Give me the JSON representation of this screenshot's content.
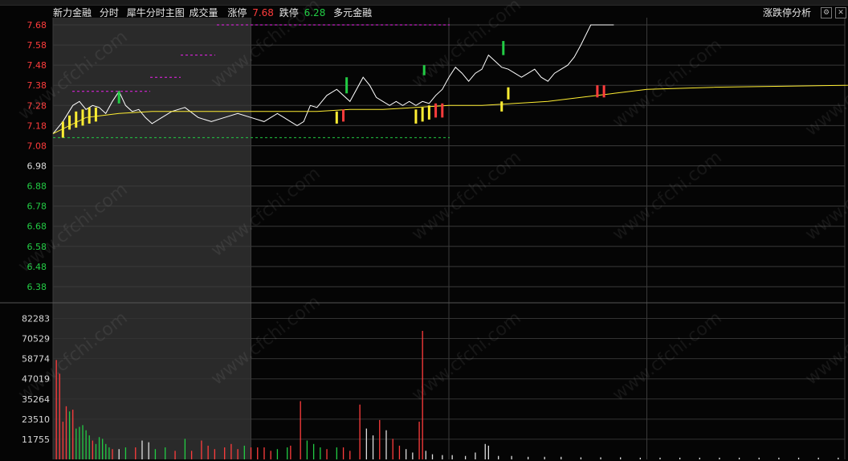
{
  "header": {
    "stock_name": "新力金融",
    "mode": "分时",
    "indicator": "犀牛分时主图",
    "volume_label": "成交量",
    "limit_up_label": "涨停",
    "limit_up_value": "7.68",
    "limit_down_label": "跌停",
    "limit_down_value": "6.28",
    "extra_label": "多元金融",
    "right_label": "涨跌停分析"
  },
  "watermark": "www.cfchi.com",
  "colors": {
    "up": "#ff3c3c",
    "down": "#22cc44",
    "neutral": "#dddddd",
    "avg_line": "#ffee33",
    "price_line": "#ffffff",
    "limit_dash": "#ee22ee",
    "low_dash": "#22cc44"
  },
  "chart_data": [
    {
      "type": "line",
      "title": "分时",
      "price_ticks": [
        "7.68",
        "7.58",
        "7.48",
        "7.38",
        "7.28",
        "7.18",
        "7.08",
        "6.98",
        "6.88",
        "6.78",
        "6.68",
        "6.58",
        "6.48",
        "6.38"
      ],
      "ylim": [
        6.32,
        7.7
      ],
      "prev_close": 6.98,
      "series": [
        {
          "name": "price",
          "x": [
            0,
            3,
            6,
            8,
            10,
            12,
            14,
            16,
            18,
            20,
            22,
            24,
            26,
            28,
            30,
            33,
            36,
            40,
            44,
            48,
            52,
            56,
            60,
            64,
            68,
            70,
            72,
            74,
            76,
            78,
            80,
            83,
            86,
            90,
            94,
            96,
            98,
            100,
            102,
            104,
            106,
            108,
            110,
            112,
            114,
            116,
            118,
            120,
            122,
            124,
            126,
            128,
            130,
            132,
            134,
            136,
            138,
            140,
            142,
            144,
            146,
            148,
            150,
            152,
            154,
            156,
            158,
            160,
            163,
            166,
            168,
            170
          ],
          "values": [
            7.14,
            7.2,
            7.28,
            7.3,
            7.26,
            7.28,
            7.27,
            7.24,
            7.3,
            7.35,
            7.28,
            7.25,
            7.26,
            7.22,
            7.19,
            7.22,
            7.25,
            7.27,
            7.22,
            7.2,
            7.22,
            7.24,
            7.22,
            7.2,
            7.24,
            7.22,
            7.2,
            7.18,
            7.2,
            7.28,
            7.27,
            7.33,
            7.36,
            7.3,
            7.42,
            7.38,
            7.32,
            7.3,
            7.28,
            7.3,
            7.28,
            7.3,
            7.28,
            7.3,
            7.29,
            7.33,
            7.36,
            7.42,
            7.47,
            7.44,
            7.4,
            7.44,
            7.46,
            7.53,
            7.5,
            7.47,
            7.46,
            7.44,
            7.42,
            7.44,
            7.46,
            7.42,
            7.4,
            7.44,
            7.46,
            7.48,
            7.52,
            7.58,
            7.68,
            7.68,
            7.68,
            7.68
          ]
        },
        {
          "name": "avg",
          "x": [
            0,
            10,
            20,
            30,
            40,
            50,
            60,
            70,
            80,
            90,
            100,
            110,
            120,
            130,
            140,
            150,
            160,
            170,
            180,
            200,
            240,
            280,
            320,
            360,
            400,
            440,
            480
          ],
          "values": [
            7.14,
            7.22,
            7.24,
            7.25,
            7.25,
            7.25,
            7.25,
            7.25,
            7.25,
            7.26,
            7.26,
            7.27,
            7.28,
            7.28,
            7.29,
            7.3,
            7.32,
            7.34,
            7.36,
            7.37,
            7.38,
            7.385,
            7.39,
            7.39,
            7.395,
            7.395,
            7.4
          ]
        }
      ],
      "limit_up": 7.68,
      "limit_down_line": 7.12
    },
    {
      "type": "bar",
      "title": "成交量",
      "vol_ticks": [
        "82283",
        "70529",
        "58774",
        "47019",
        "35264",
        "23510",
        "11755"
      ],
      "ylim": [
        0,
        90000
      ],
      "max_time": 240,
      "bars": [
        {
          "t": 1,
          "v": 58000,
          "c": "up"
        },
        {
          "t": 2,
          "v": 50000,
          "c": "up"
        },
        {
          "t": 3,
          "v": 22000,
          "c": "up"
        },
        {
          "t": 4,
          "v": 31000,
          "c": "up"
        },
        {
          "t": 5,
          "v": 28000,
          "c": "down"
        },
        {
          "t": 6,
          "v": 29000,
          "c": "up"
        },
        {
          "t": 7,
          "v": 18000,
          "c": "down"
        },
        {
          "t": 8,
          "v": 19000,
          "c": "down"
        },
        {
          "t": 9,
          "v": 20000,
          "c": "down"
        },
        {
          "t": 10,
          "v": 17000,
          "c": "down"
        },
        {
          "t": 11,
          "v": 14000,
          "c": "down"
        },
        {
          "t": 12,
          "v": 11000,
          "c": "up"
        },
        {
          "t": 13,
          "v": 9000,
          "c": "down"
        },
        {
          "t": 14,
          "v": 13000,
          "c": "down"
        },
        {
          "t": 15,
          "v": 12000,
          "c": "down"
        },
        {
          "t": 16,
          "v": 9000,
          "c": "down"
        },
        {
          "t": 17,
          "v": 7000,
          "c": "down"
        },
        {
          "t": 18,
          "v": 6000,
          "c": "up"
        },
        {
          "t": 20,
          "v": 6000,
          "c": "neutral"
        },
        {
          "t": 22,
          "v": 7000,
          "c": "down"
        },
        {
          "t": 25,
          "v": 7000,
          "c": "up"
        },
        {
          "t": 27,
          "v": 11000,
          "c": "neutral"
        },
        {
          "t": 29,
          "v": 10000,
          "c": "neutral"
        },
        {
          "t": 31,
          "v": 6000,
          "c": "down"
        },
        {
          "t": 34,
          "v": 7000,
          "c": "down"
        },
        {
          "t": 37,
          "v": 5000,
          "c": "up"
        },
        {
          "t": 40,
          "v": 12000,
          "c": "down"
        },
        {
          "t": 42,
          "v": 5000,
          "c": "up"
        },
        {
          "t": 45,
          "v": 11000,
          "c": "up"
        },
        {
          "t": 47,
          "v": 8000,
          "c": "up"
        },
        {
          "t": 49,
          "v": 6000,
          "c": "up"
        },
        {
          "t": 52,
          "v": 7000,
          "c": "up"
        },
        {
          "t": 54,
          "v": 9000,
          "c": "up"
        },
        {
          "t": 56,
          "v": 6000,
          "c": "up"
        },
        {
          "t": 58,
          "v": 8000,
          "c": "down"
        },
        {
          "t": 60,
          "v": 7000,
          "c": "up"
        },
        {
          "t": 62,
          "v": 7000,
          "c": "up"
        },
        {
          "t": 64,
          "v": 7000,
          "c": "up"
        },
        {
          "t": 66,
          "v": 5000,
          "c": "up"
        },
        {
          "t": 68,
          "v": 6000,
          "c": "down"
        },
        {
          "t": 71,
          "v": 7000,
          "c": "down"
        },
        {
          "t": 72,
          "v": 8000,
          "c": "up"
        },
        {
          "t": 75,
          "v": 34000,
          "c": "up"
        },
        {
          "t": 77,
          "v": 11000,
          "c": "down"
        },
        {
          "t": 79,
          "v": 9000,
          "c": "down"
        },
        {
          "t": 81,
          "v": 7000,
          "c": "down"
        },
        {
          "t": 83,
          "v": 6000,
          "c": "up"
        },
        {
          "t": 86,
          "v": 7000,
          "c": "down"
        },
        {
          "t": 88,
          "v": 7000,
          "c": "up"
        },
        {
          "t": 90,
          "v": 5000,
          "c": "up"
        },
        {
          "t": 93,
          "v": 32000,
          "c": "up"
        },
        {
          "t": 95,
          "v": 18000,
          "c": "neutral"
        },
        {
          "t": 97,
          "v": 14000,
          "c": "neutral"
        },
        {
          "t": 99,
          "v": 23000,
          "c": "up"
        },
        {
          "t": 101,
          "v": 17000,
          "c": "neutral"
        },
        {
          "t": 103,
          "v": 12000,
          "c": "up"
        },
        {
          "t": 105,
          "v": 8000,
          "c": "up"
        },
        {
          "t": 107,
          "v": 6000,
          "c": "neutral"
        },
        {
          "t": 109,
          "v": 4000,
          "c": "neutral"
        },
        {
          "t": 111,
          "v": 22000,
          "c": "up"
        },
        {
          "t": 112,
          "v": 75000,
          "c": "up"
        },
        {
          "t": 113,
          "v": 5000,
          "c": "neutral"
        },
        {
          "t": 115,
          "v": 3000,
          "c": "neutral"
        },
        {
          "t": 118,
          "v": 2500,
          "c": "neutral"
        },
        {
          "t": 121,
          "v": 2500,
          "c": "neutral"
        },
        {
          "t": 125,
          "v": 2000,
          "c": "neutral"
        },
        {
          "t": 128,
          "v": 4000,
          "c": "neutral"
        },
        {
          "t": 131,
          "v": 9000,
          "c": "neutral"
        },
        {
          "t": 132,
          "v": 8000,
          "c": "neutral"
        },
        {
          "t": 135,
          "v": 2000,
          "c": "neutral"
        },
        {
          "t": 139,
          "v": 2000,
          "c": "neutral"
        },
        {
          "t": 144,
          "v": 1500,
          "c": "neutral"
        },
        {
          "t": 149,
          "v": 1500,
          "c": "neutral"
        },
        {
          "t": 154,
          "v": 1500,
          "c": "neutral"
        },
        {
          "t": 160,
          "v": 1200,
          "c": "neutral"
        },
        {
          "t": 166,
          "v": 1200,
          "c": "neutral"
        },
        {
          "t": 172,
          "v": 1200,
          "c": "neutral"
        },
        {
          "t": 178,
          "v": 1000,
          "c": "neutral"
        },
        {
          "t": 184,
          "v": 1000,
          "c": "neutral"
        },
        {
          "t": 190,
          "v": 1000,
          "c": "neutral"
        },
        {
          "t": 196,
          "v": 1000,
          "c": "neutral"
        },
        {
          "t": 202,
          "v": 1000,
          "c": "neutral"
        },
        {
          "t": 208,
          "v": 1000,
          "c": "neutral"
        },
        {
          "t": 214,
          "v": 1000,
          "c": "neutral"
        },
        {
          "t": 220,
          "v": 1000,
          "c": "neutral"
        },
        {
          "t": 226,
          "v": 1000,
          "c": "neutral"
        },
        {
          "t": 232,
          "v": 1000,
          "c": "neutral"
        },
        {
          "t": 238,
          "v": 1000,
          "c": "neutral"
        }
      ]
    }
  ]
}
